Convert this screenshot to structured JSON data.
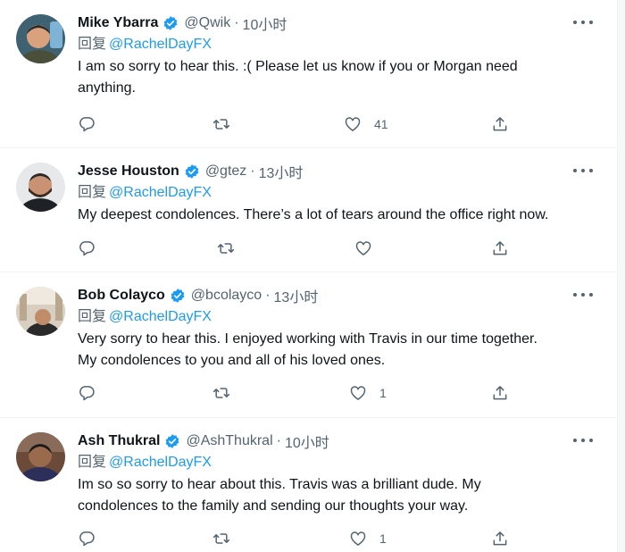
{
  "colors": {
    "accent": "#1d9bf0",
    "muted": "#536471",
    "text": "#0f1419"
  },
  "tweets": [
    {
      "name": "Mike Ybarra",
      "handle": "@Qwik",
      "time": "10小时",
      "reply_prefix": "回复",
      "reply_to": "@RachelDayFX",
      "lines": [
        "I am so sorry to hear this. :( Please let us know if you or Morgan need",
        "anything."
      ],
      "likes": "41"
    },
    {
      "name": "Jesse Houston",
      "handle": "@gtez",
      "time": "13小时",
      "reply_prefix": "回复",
      "reply_to": "@RachelDayFX",
      "lines": [
        "My deepest condolences. There’s a lot of tears around the office right now."
      ],
      "likes": ""
    },
    {
      "name": "Bob Colayco",
      "handle": "@bcolayco",
      "time": "13小时",
      "reply_prefix": "回复",
      "reply_to": "@RachelDayFX",
      "lines": [
        "Very sorry to hear this. I enjoyed working with Travis in our time together.",
        "My condolences to you and all of his loved ones."
      ],
      "likes": "1"
    },
    {
      "name": "Ash Thukral",
      "handle": "@AshThukral",
      "time": "10小时",
      "reply_prefix": "回复",
      "reply_to": "@RachelDayFX",
      "lines": [
        "Im so so sorry to hear about this. Travis was a brilliant dude. My",
        "condolences to the family and sending our thoughts your way."
      ],
      "likes": "1"
    }
  ],
  "icons": {
    "verified": "verified-badge-icon",
    "more": "more-icon",
    "reply": "reply-icon",
    "retweet": "retweet-icon",
    "like": "heart-icon",
    "share": "share-icon"
  }
}
